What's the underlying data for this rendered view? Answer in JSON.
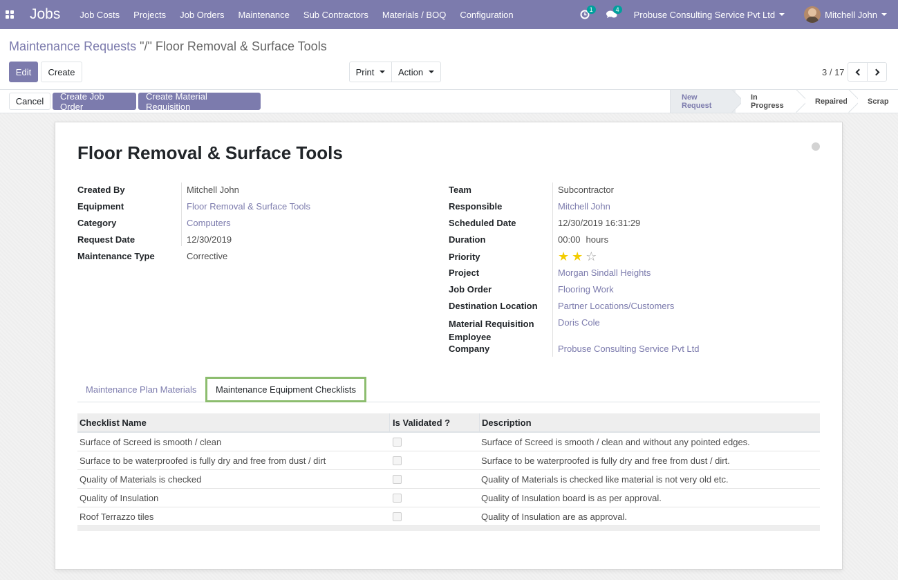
{
  "navbar": {
    "brand": "Jobs",
    "menu": [
      "Job Costs",
      "Projects",
      "Job Orders",
      "Maintenance",
      "Sub Contractors",
      "Materials / BOQ",
      "Configuration"
    ],
    "activity_count": "1",
    "message_count": "4",
    "company": "Probuse Consulting Service Pvt Ltd",
    "user": "Mitchell John",
    "accent_color": "#7c7bad"
  },
  "breadcrumb": {
    "parent": "Maintenance Requests",
    "separator": " \"/\" ",
    "current": "Floor Removal & Surface Tools"
  },
  "controls": {
    "edit": "Edit",
    "create": "Create",
    "print": "Print",
    "action": "Action",
    "pager": "3 / 17"
  },
  "statusbar": {
    "cancel": "Cancel",
    "create_job_order": "Create Job Order",
    "create_material_requisition": "Create Material Requisition",
    "stages": [
      {
        "label": "New Request",
        "active": true
      },
      {
        "label": "In Progress",
        "active": false
      },
      {
        "label": "Repaired",
        "active": false
      },
      {
        "label": "Scrap",
        "active": false
      }
    ]
  },
  "form": {
    "title": "Floor Removal & Surface Tools",
    "left": [
      {
        "label": "Created By",
        "value": "Mitchell John",
        "link": false
      },
      {
        "label": "Equipment",
        "value": "Floor Removal & Surface Tools",
        "link": true
      },
      {
        "label": "Category",
        "value": "Computers",
        "link": true
      },
      {
        "label": "Request Date",
        "value": "12/30/2019",
        "link": false
      },
      {
        "label": "Maintenance Type",
        "value": "Corrective",
        "link": false
      }
    ],
    "right": {
      "team_label": "Team",
      "team": "Subcontractor",
      "responsible_label": "Responsible",
      "responsible": "Mitchell John",
      "scheduled_label": "Scheduled Date",
      "scheduled": "12/30/2019 16:31:29",
      "duration_label": "Duration",
      "duration": "00:00",
      "duration_unit": "hours",
      "priority_label": "Priority",
      "priority": 2,
      "priority_max": 3,
      "project_label": "Project",
      "project": "Morgan Sindall Heights",
      "job_order_label": "Job Order",
      "job_order": "Flooring Work",
      "destination_label": "Destination Location",
      "destination": "Partner Locations/Customers",
      "mr_employee_label_1": "Material Requisition",
      "mr_employee_label_2": "Employee",
      "mr_employee": "Doris Cole",
      "company_label": "Company",
      "company": "Probuse Consulting Service Pvt Ltd"
    }
  },
  "tabs": {
    "plan_materials": "Maintenance Plan Materials",
    "equipment_checklists": "Maintenance Equipment Checklists"
  },
  "checklist": {
    "headers": [
      "Checklist Name",
      "Is Validated ?",
      "Description"
    ],
    "rows": [
      {
        "name": "Surface of Screed is smooth / clean",
        "validated": false,
        "description": "Surface of Screed is smooth / clean and without any pointed edges."
      },
      {
        "name": "Surface to be waterproofed is fully dry and free from dust / dirt",
        "validated": false,
        "description": "Surface to be waterproofed is fully dry and free from dust / dirt."
      },
      {
        "name": "Quality of Materials is checked",
        "validated": false,
        "description": "Quality of Materials is checked like material is not very old etc."
      },
      {
        "name": "Quality of Insulation",
        "validated": false,
        "description": "Quality of Insulation board is as per approval."
      },
      {
        "name": "Roof Terrazzo tiles",
        "validated": false,
        "description": "Quality of Insulation are as approval."
      }
    ]
  }
}
